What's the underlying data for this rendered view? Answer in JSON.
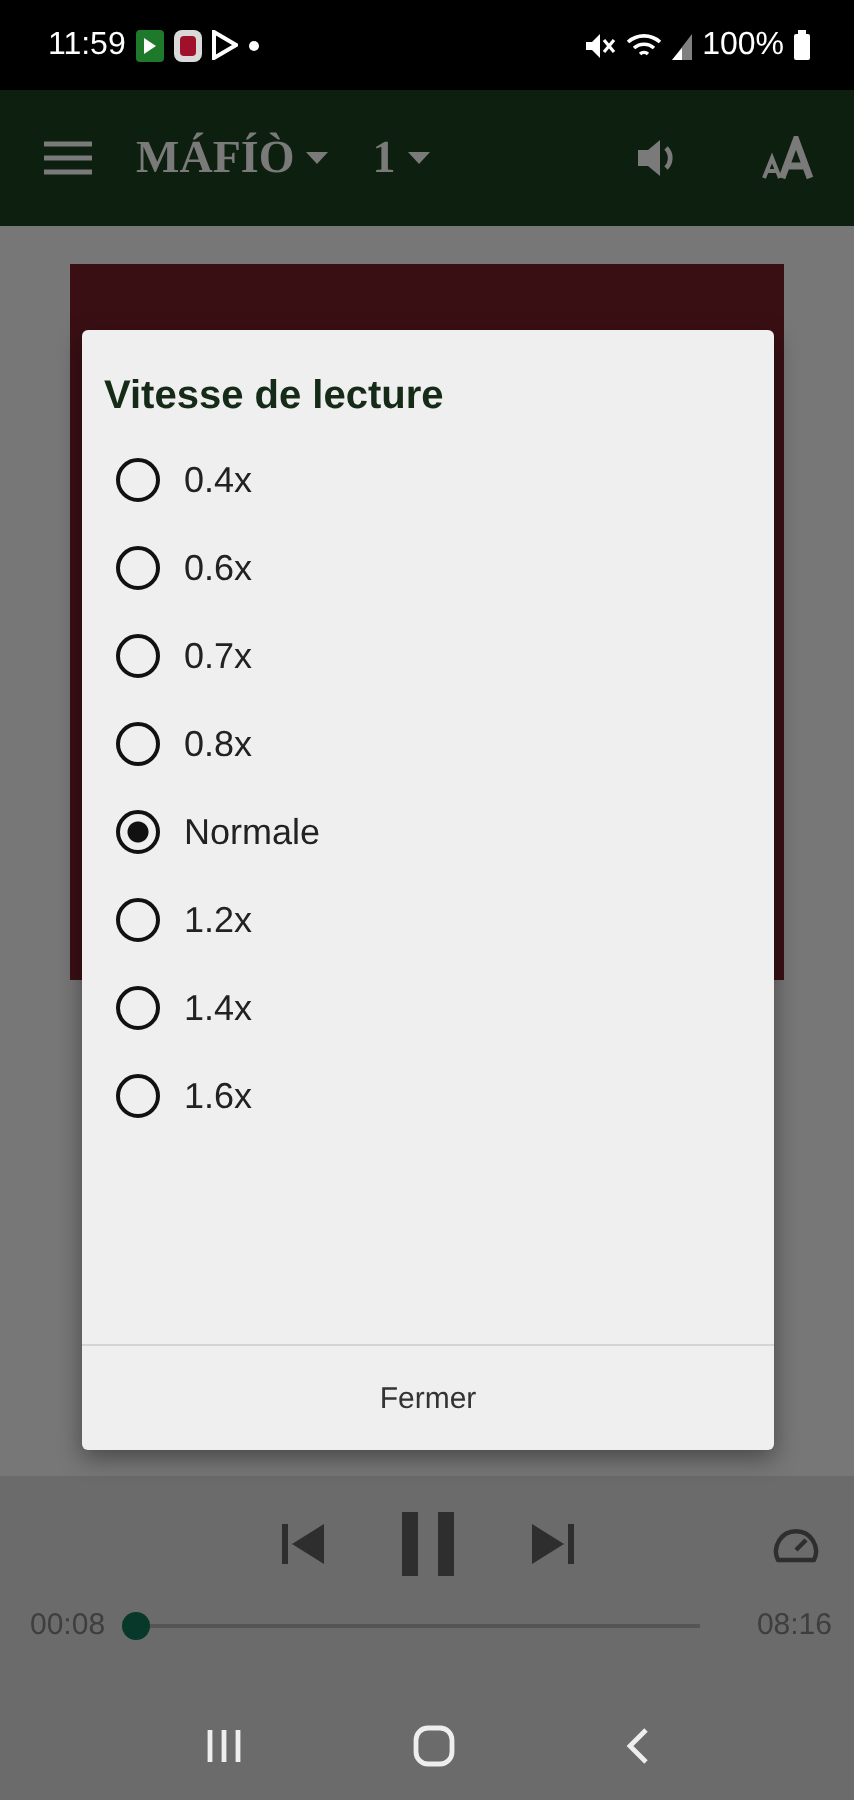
{
  "status_bar": {
    "time": "11:59",
    "battery": "100%"
  },
  "app_bar": {
    "book": "MÁFÍÒ",
    "chapter": "1"
  },
  "dialog": {
    "title": "Vitesse de lecture",
    "options": [
      {
        "label": "0.4x",
        "selected": false
      },
      {
        "label": "0.6x",
        "selected": false
      },
      {
        "label": "0.7x",
        "selected": false
      },
      {
        "label": "0.8x",
        "selected": false
      },
      {
        "label": "Normale",
        "selected": true
      },
      {
        "label": "1.2x",
        "selected": false
      },
      {
        "label": "1.4x",
        "selected": false
      },
      {
        "label": "1.6x",
        "selected": false
      }
    ],
    "close_button": "Fermer"
  },
  "player": {
    "elapsed": "00:08",
    "total": "08:16",
    "level": 0.02
  }
}
